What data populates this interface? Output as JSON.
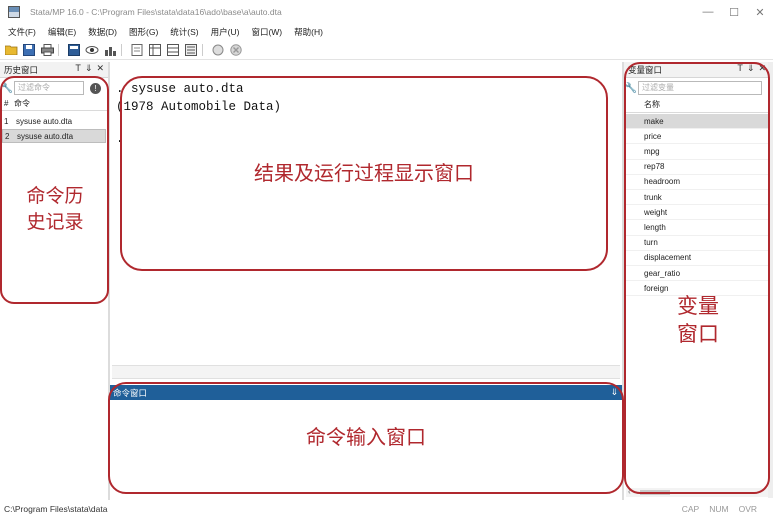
{
  "window": {
    "title": "Stata/MP 16.0 - C:\\Program Files\\stata\\data16\\ado\\base\\a\\auto.dta",
    "controls": [
      "—",
      "☐",
      "✕"
    ]
  },
  "menu": [
    "文件(F)",
    "编辑(E)",
    "数据(D)",
    "图形(G)",
    "统计(S)",
    "用户(U)",
    "窗口(W)",
    "帮助(H)"
  ],
  "history": {
    "title": "历史窗口",
    "filter_placeholder": "过滤命令",
    "col_num": "#",
    "col_cmd": "命令",
    "items": [
      {
        "num": "1",
        "cmd": "sysuse auto.dta"
      },
      {
        "num": "2",
        "cmd": "sysuse auto.dta"
      }
    ]
  },
  "results": {
    "line1": ". sysuse auto.dta",
    "line2": "(1978 Automobile Data)",
    "line3": "."
  },
  "command": {
    "title": "命令窗口"
  },
  "variables": {
    "title": "变量窗口",
    "filter_placeholder": "过滤变量",
    "col_name": "名称",
    "items": [
      "make",
      "price",
      "mpg",
      "rep78",
      "headroom",
      "trunk",
      "weight",
      "length",
      "turn",
      "displacement",
      "gear_ratio",
      "foreign"
    ],
    "selected": "make"
  },
  "status": {
    "path": "C:\\Program Files\\stata\\data",
    "cap": "CAP",
    "num": "NUM",
    "ovr": "OVR"
  },
  "annotations": {
    "history_label_1": "命令历",
    "history_label_2": "史记录",
    "results_label": "结果及运行过程显示窗口",
    "command_label": "命令输入窗口",
    "variables_label_1": "变量",
    "variables_label_2": "窗口",
    "color": "#b0282e"
  }
}
